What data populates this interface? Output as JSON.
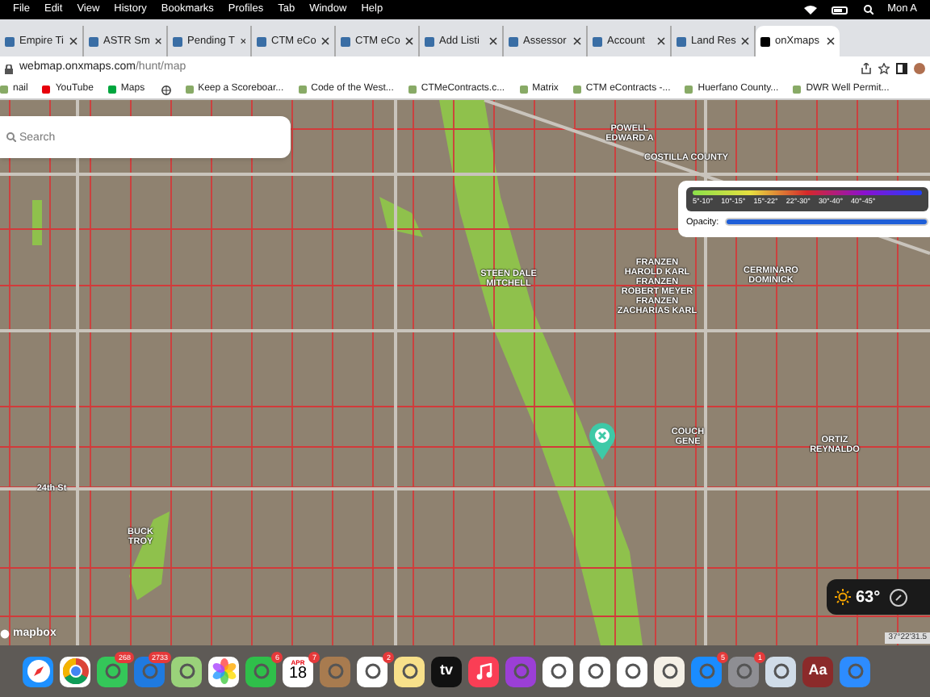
{
  "menu_bar": {
    "items": [
      "File",
      "Edit",
      "View",
      "History",
      "Bookmarks",
      "Profiles",
      "Tab",
      "Window",
      "Help"
    ],
    "clock": "Mon A"
  },
  "tabs": [
    {
      "label": "Empire Ti",
      "selected": false
    },
    {
      "label": "ASTR Sm",
      "selected": false
    },
    {
      "label": "Pending T",
      "selected": false
    },
    {
      "label": "CTM eCo",
      "selected": false
    },
    {
      "label": "CTM eCo",
      "selected": false
    },
    {
      "label": "Add Listi",
      "selected": false
    },
    {
      "label": "Assessor",
      "selected": false
    },
    {
      "label": "Account",
      "selected": false
    },
    {
      "label": "Land Res",
      "selected": false
    },
    {
      "label": "onXmaps",
      "selected": true
    }
  ],
  "address_bar": {
    "domain": "webmap.onxmaps.com",
    "path": "/hunt/map"
  },
  "bookmarks": [
    "nail",
    "YouTube",
    "Maps",
    "Keep a Scoreboar...",
    "Code of the West...",
    "CTMeContracts.c...",
    "Matrix",
    "CTM eContracts -...",
    "Huerfano County...",
    "DWR Well Permit..."
  ],
  "map": {
    "search": {
      "placeholder": "Search"
    },
    "legend": {
      "ranges": [
        "5°-10°",
        "10°-15°",
        "15°-22°",
        "22°-30°",
        "30°-40°",
        "40°-45°"
      ],
      "opacity_label": "Opacity:",
      "opacity": {
        "level": 1
      }
    },
    "labels": [
      "POWELL EDWARD A",
      "COSTILLA COUNTY",
      "STEEN DALE MITCHELL",
      "FRANZEN HAROLD KARL FRANZEN ROBERT MEYER FRANZEN ZACHARIAS KARL",
      "CERMINARO DOMINICK",
      "COUCH GENE",
      "ORTIZ REYNALDO",
      "BUCK TROY",
      "24th St"
    ],
    "weather": {
      "temperature": "63°"
    },
    "attribution": "mapbox",
    "coordinates": "37°22'31.5"
  },
  "dock": [
    {
      "kind": "safari"
    },
    {
      "kind": "chrome"
    },
    {
      "kind": "messages",
      "badge": "268"
    },
    {
      "kind": "mail",
      "badge": "2733"
    },
    {
      "kind": "maps"
    },
    {
      "kind": "photos"
    },
    {
      "kind": "facetime",
      "badge": "6"
    },
    {
      "kind": "calendar",
      "badge": "7",
      "month": "APR",
      "day": "18"
    },
    {
      "kind": "contacts"
    },
    {
      "kind": "reminders",
      "badge": "2"
    },
    {
      "kind": "notes"
    },
    {
      "kind": "tv",
      "text": "tv"
    },
    {
      "kind": "music"
    },
    {
      "kind": "podcasts"
    },
    {
      "kind": "news"
    },
    {
      "kind": "keynote"
    },
    {
      "kind": "numbers"
    },
    {
      "kind": "pages"
    },
    {
      "kind": "appstore",
      "badge": "5"
    },
    {
      "kind": "settings",
      "badge": "1"
    },
    {
      "kind": "preview"
    },
    {
      "kind": "dictionary",
      "text": "Aa"
    },
    {
      "kind": "zoom"
    }
  ]
}
